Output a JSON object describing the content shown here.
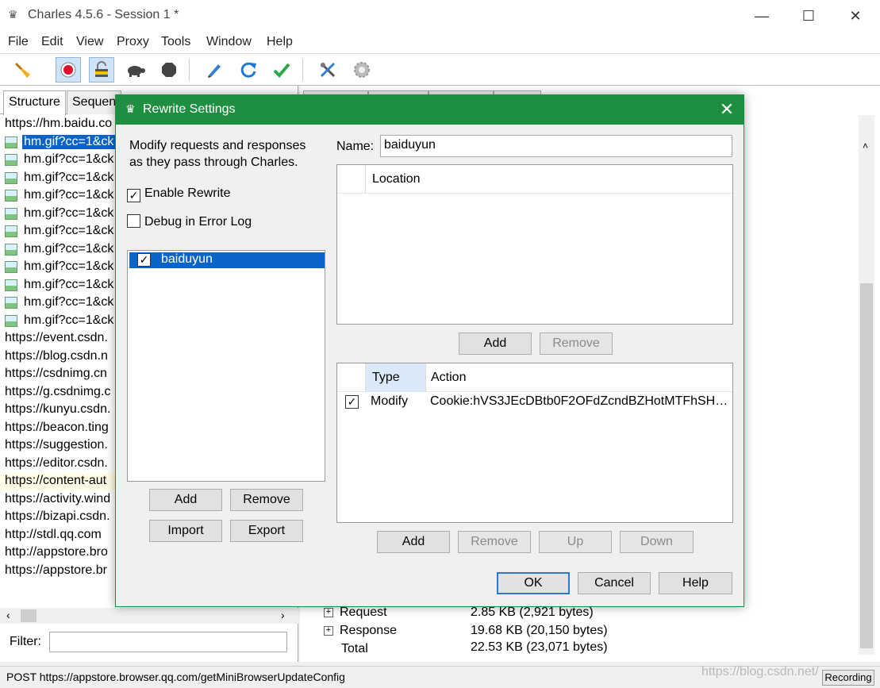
{
  "window": {
    "title": "Charles 4.5.6 - Session 1 *",
    "minimize": "—",
    "maximize": "☐",
    "close": "✕"
  },
  "menu": [
    "File",
    "Edit",
    "View",
    "Proxy",
    "Tools",
    "Window",
    "Help"
  ],
  "toolbar": {
    "icons": [
      "broom-icon",
      "record-icon",
      "ssl-proxy-icon",
      "throttle-turtle-icon",
      "breakpoint-stop-icon",
      "compose-pen-icon",
      "repeat-icon",
      "validate-check-icon",
      "tools-icon",
      "settings-gear-icon"
    ]
  },
  "left": {
    "tabs": [
      "Structure",
      "Sequen"
    ],
    "tree": [
      {
        "label": "https://hm.baidu.co",
        "type": "host"
      },
      {
        "label": "hm.gif?cc=1&ck",
        "type": "img",
        "selected": true
      },
      {
        "label": "hm.gif?cc=1&ck",
        "type": "img"
      },
      {
        "label": "hm.gif?cc=1&ck",
        "type": "img"
      },
      {
        "label": "hm.gif?cc=1&ck",
        "type": "img"
      },
      {
        "label": "hm.gif?cc=1&ck",
        "type": "img"
      },
      {
        "label": "hm.gif?cc=1&ck",
        "type": "img"
      },
      {
        "label": "hm.gif?cc=1&ck",
        "type": "img"
      },
      {
        "label": "hm.gif?cc=1&ck",
        "type": "img"
      },
      {
        "label": "hm.gif?cc=1&ck",
        "type": "img"
      },
      {
        "label": "hm.gif?cc=1&ck",
        "type": "img"
      },
      {
        "label": "hm.gif?cc=1&ck",
        "type": "img"
      },
      {
        "label": "https://event.csdn.",
        "type": "host"
      },
      {
        "label": "https://blog.csdn.n",
        "type": "host"
      },
      {
        "label": "https://csdnimg.cn",
        "type": "host"
      },
      {
        "label": "https://g.csdnimg.c",
        "type": "host"
      },
      {
        "label": "https://kunyu.csdn.",
        "type": "host"
      },
      {
        "label": "https://beacon.ting",
        "type": "host"
      },
      {
        "label": "https://suggestion.",
        "type": "host"
      },
      {
        "label": "https://editor.csdn.",
        "type": "host"
      },
      {
        "label": "https://content-aut",
        "type": "host",
        "highlight": true
      },
      {
        "label": "https://activity.wind",
        "type": "host"
      },
      {
        "label": "https://bizapi.csdn.",
        "type": "host"
      },
      {
        "label": "http://stdl.qq.com",
        "type": "host"
      },
      {
        "label": "http://appstore.bro",
        "type": "host"
      },
      {
        "label": "https://appstore.br",
        "type": "host"
      }
    ],
    "filter_label": "Filter:",
    "filter_value": ""
  },
  "right": {
    "sizes": [
      {
        "label": "Request",
        "value": "2.85 KB (2,921 bytes)",
        "expandable": true
      },
      {
        "label": "Response",
        "value": "19.68 KB (20,150 bytes)",
        "expandable": true
      },
      {
        "label": "Total",
        "value": "22.53 KB (23,071 bytes)",
        "expandable": false
      }
    ]
  },
  "status": {
    "text": "POST https://appstore.browser.qq.com/getMiniBrowserUpdateConfig",
    "recording": "Recording",
    "watermark": "https://blog.csdn.net/"
  },
  "dialog": {
    "title": "Rewrite Settings",
    "close": "✕",
    "description": "Modify requests and responses as they pass through Charles.",
    "enable_rewrite": {
      "label": "Enable Rewrite",
      "checked": true
    },
    "debug_log": {
      "label": "Debug in Error Log",
      "checked": false
    },
    "sets": [
      {
        "name": "baiduyun",
        "checked": true
      }
    ],
    "set_buttons": {
      "add": "Add",
      "remove": "Remove",
      "import": "Import",
      "export": "Export"
    },
    "name_label": "Name:",
    "name_value": "baiduyun",
    "location_header": "Location",
    "location_buttons": {
      "add": "Add",
      "remove": "Remove"
    },
    "rules_headers": {
      "type": "Type",
      "action": "Action"
    },
    "rules": [
      {
        "checked": true,
        "type": "Modify",
        "action": "Cookie:hVS3JEcDBtb0F2OFdZcndBZHotMTFhSHJH..."
      }
    ],
    "rule_buttons": {
      "add": "Add",
      "remove": "Remove",
      "up": "Up",
      "down": "Down"
    },
    "footer": {
      "ok": "OK",
      "cancel": "Cancel",
      "help": "Help"
    }
  }
}
